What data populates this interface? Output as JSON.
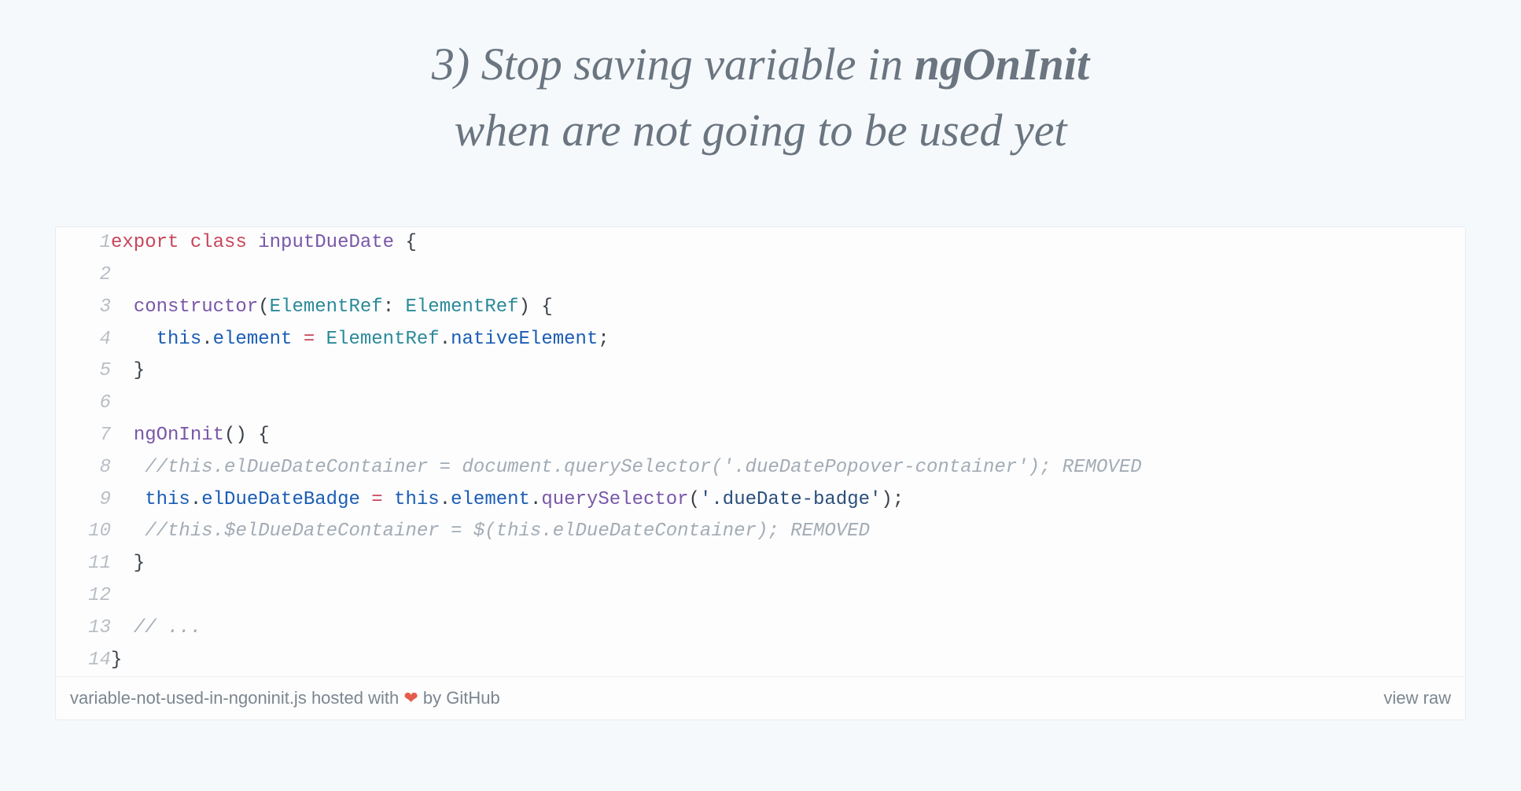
{
  "heading": {
    "prefix": "3) Stop saving variable in ",
    "bold": "ngOnInit",
    "line2": "when are not going to be used yet"
  },
  "code": {
    "lines": [
      {
        "num": "1",
        "tokens": [
          {
            "t": "export",
            "c": "kw-red"
          },
          {
            "t": " ",
            "c": ""
          },
          {
            "t": "class",
            "c": "kw-red"
          },
          {
            "t": " ",
            "c": ""
          },
          {
            "t": "inputDueDate",
            "c": "fn-purple"
          },
          {
            "t": " {",
            "c": "punct"
          }
        ]
      },
      {
        "num": "2",
        "tokens": []
      },
      {
        "num": "3",
        "tokens": [
          {
            "t": "  ",
            "c": ""
          },
          {
            "t": "constructor",
            "c": "fn-purple"
          },
          {
            "t": "(",
            "c": "punct"
          },
          {
            "t": "ElementRef",
            "c": "type-teal"
          },
          {
            "t": ": ",
            "c": "punct"
          },
          {
            "t": "ElementRef",
            "c": "type-teal"
          },
          {
            "t": ") {",
            "c": "punct"
          }
        ]
      },
      {
        "num": "4",
        "tokens": [
          {
            "t": "    ",
            "c": ""
          },
          {
            "t": "this",
            "c": "kw-blue"
          },
          {
            "t": ".",
            "c": "punct"
          },
          {
            "t": "element",
            "c": "kw-blue"
          },
          {
            "t": " ",
            "c": ""
          },
          {
            "t": "=",
            "c": "operator"
          },
          {
            "t": " ",
            "c": ""
          },
          {
            "t": "ElementRef",
            "c": "type-teal"
          },
          {
            "t": ".",
            "c": "punct"
          },
          {
            "t": "nativeElement",
            "c": "kw-blue"
          },
          {
            "t": ";",
            "c": "punct"
          }
        ]
      },
      {
        "num": "5",
        "tokens": [
          {
            "t": "  }",
            "c": "punct"
          }
        ]
      },
      {
        "num": "6",
        "tokens": []
      },
      {
        "num": "7",
        "tokens": [
          {
            "t": "  ",
            "c": ""
          },
          {
            "t": "ngOnInit",
            "c": "fn-purple"
          },
          {
            "t": "() {",
            "c": "punct"
          }
        ]
      },
      {
        "num": "8",
        "tokens": [
          {
            "t": "   ",
            "c": ""
          },
          {
            "t": "//this.elDueDateContainer = document.querySelector('.dueDatePopover-container'); REMOVED",
            "c": "comment"
          }
        ]
      },
      {
        "num": "9",
        "tokens": [
          {
            "t": "   ",
            "c": ""
          },
          {
            "t": "this",
            "c": "kw-blue"
          },
          {
            "t": ".",
            "c": "punct"
          },
          {
            "t": "elDueDateBadge",
            "c": "kw-blue"
          },
          {
            "t": " ",
            "c": ""
          },
          {
            "t": "=",
            "c": "operator"
          },
          {
            "t": " ",
            "c": ""
          },
          {
            "t": "this",
            "c": "kw-blue"
          },
          {
            "t": ".",
            "c": "punct"
          },
          {
            "t": "element",
            "c": "kw-blue"
          },
          {
            "t": ".",
            "c": "punct"
          },
          {
            "t": "querySelector",
            "c": "fn-purple"
          },
          {
            "t": "(",
            "c": "punct"
          },
          {
            "t": "'.dueDate-badge'",
            "c": "string"
          },
          {
            "t": ");",
            "c": "punct"
          }
        ]
      },
      {
        "num": "10",
        "tokens": [
          {
            "t": "   ",
            "c": ""
          },
          {
            "t": "//this.$elDueDateContainer = $(this.elDueDateContainer); REMOVED",
            "c": "comment"
          }
        ]
      },
      {
        "num": "11",
        "tokens": [
          {
            "t": "  }",
            "c": "punct"
          }
        ]
      },
      {
        "num": "12",
        "tokens": []
      },
      {
        "num": "13",
        "tokens": [
          {
            "t": "  ",
            "c": ""
          },
          {
            "t": "// ...",
            "c": "comment"
          }
        ]
      },
      {
        "num": "14",
        "tokens": [
          {
            "t": "}",
            "c": "punct"
          }
        ]
      }
    ]
  },
  "footer": {
    "filename": "variable-not-used-in-ngoninit.js",
    "hosted_with": " hosted with ",
    "heart": "❤",
    "by": " by ",
    "host": "GitHub",
    "view_raw": "view raw"
  }
}
